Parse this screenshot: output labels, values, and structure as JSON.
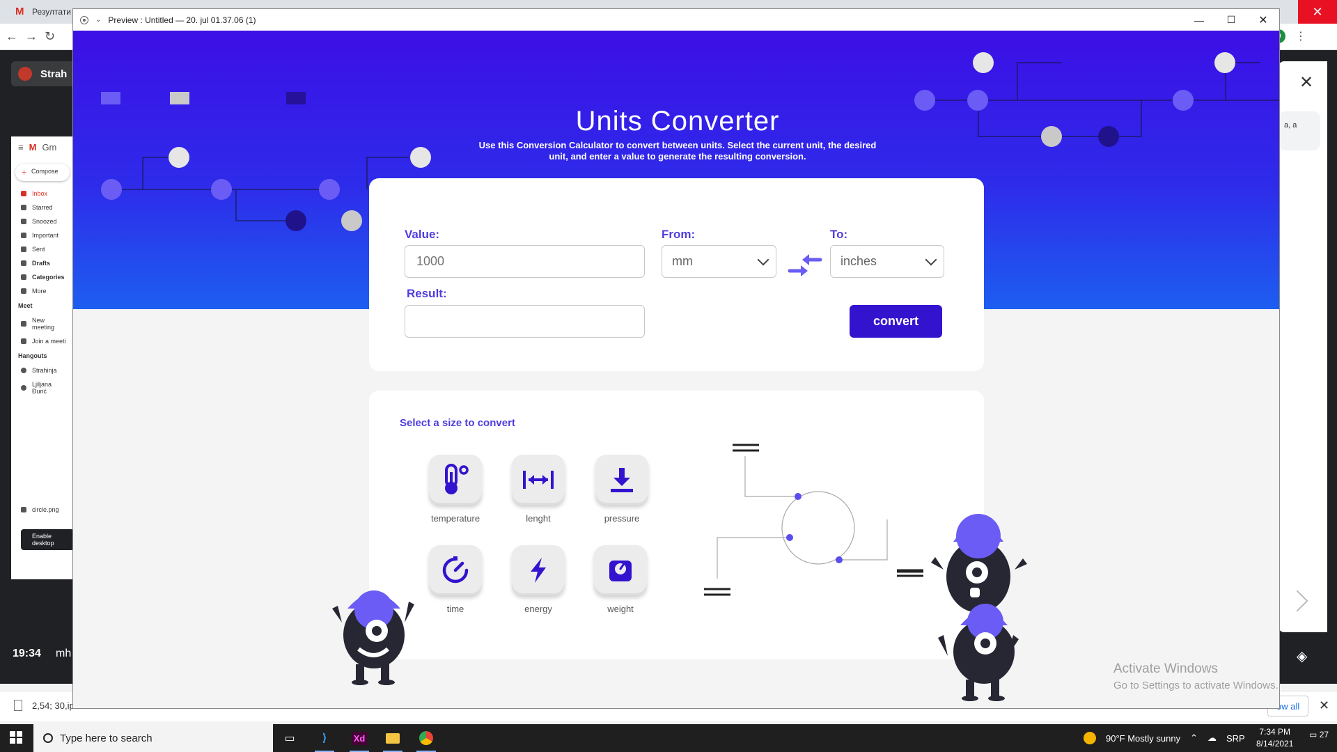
{
  "background": {
    "tab_gmail": "Резултати п",
    "strah_label": "Strah",
    "gmail_app_label": "Gm",
    "gmail": {
      "compose": "Compose",
      "items": [
        "Inbox",
        "Starred",
        "Snoozed",
        "Important",
        "Sent",
        "Drafts",
        "Categories",
        "More"
      ],
      "meet_title": "Meet",
      "meet_items": [
        "New meeting",
        "Join a meeti"
      ],
      "hangouts_title": "Hangouts",
      "hangouts_items": [
        "Strahinja",
        "Ljiljana Đurić"
      ],
      "file": "circle.png"
    },
    "enable_desktop": "Enable desktop",
    "clock_small": "19:34",
    "mh": "mh",
    "download_file": "2,54; 30,ip",
    "show_all": "ow all",
    "right_chip": "a, a",
    "avatar_letter": "D"
  },
  "window": {
    "title": "Preview : Untitled — 20. jul 01.37.06 (1)"
  },
  "hero": {
    "title": "Units Converter",
    "subtitle": "Use this Conversion Calculator to convert between units. Select the current unit, the desired unit, and enter a value to generate the resulting conversion."
  },
  "converter": {
    "value_label": "Value:",
    "value_placeholder": "1000",
    "from_label": "From:",
    "from_value": "mm",
    "to_label": "To:",
    "to_value": "inches",
    "result_label": "Result:",
    "result_value": "",
    "convert_label": "convert"
  },
  "sizes": {
    "title": "Select a size to convert",
    "items": [
      {
        "label": "temperature",
        "icon": "thermometer-icon"
      },
      {
        "label": "lenght",
        "icon": "width-arrows-icon"
      },
      {
        "label": "pressure",
        "icon": "download-icon"
      },
      {
        "label": "time",
        "icon": "timer-icon"
      },
      {
        "label": "energy",
        "icon": "lightning-icon"
      },
      {
        "label": "weight",
        "icon": "scale-icon"
      }
    ]
  },
  "activate_windows": {
    "line1": "Activate Windows",
    "line2": "Go to Settings to activate Windows."
  },
  "taskbar": {
    "search_placeholder": "Type here to search",
    "weather": "90°F  Mostly sunny",
    "lang": "SRP",
    "time": "7:34 PM",
    "date": "8/14/2021",
    "notifications": "27"
  },
  "colors": {
    "accent": "#3413cf",
    "hero_top": "#3c0fe6",
    "hero_bottom": "#1d5ef0",
    "label": "#4f3ce0",
    "monster_body": "#262733",
    "monster_hat": "#6a5cf5"
  }
}
